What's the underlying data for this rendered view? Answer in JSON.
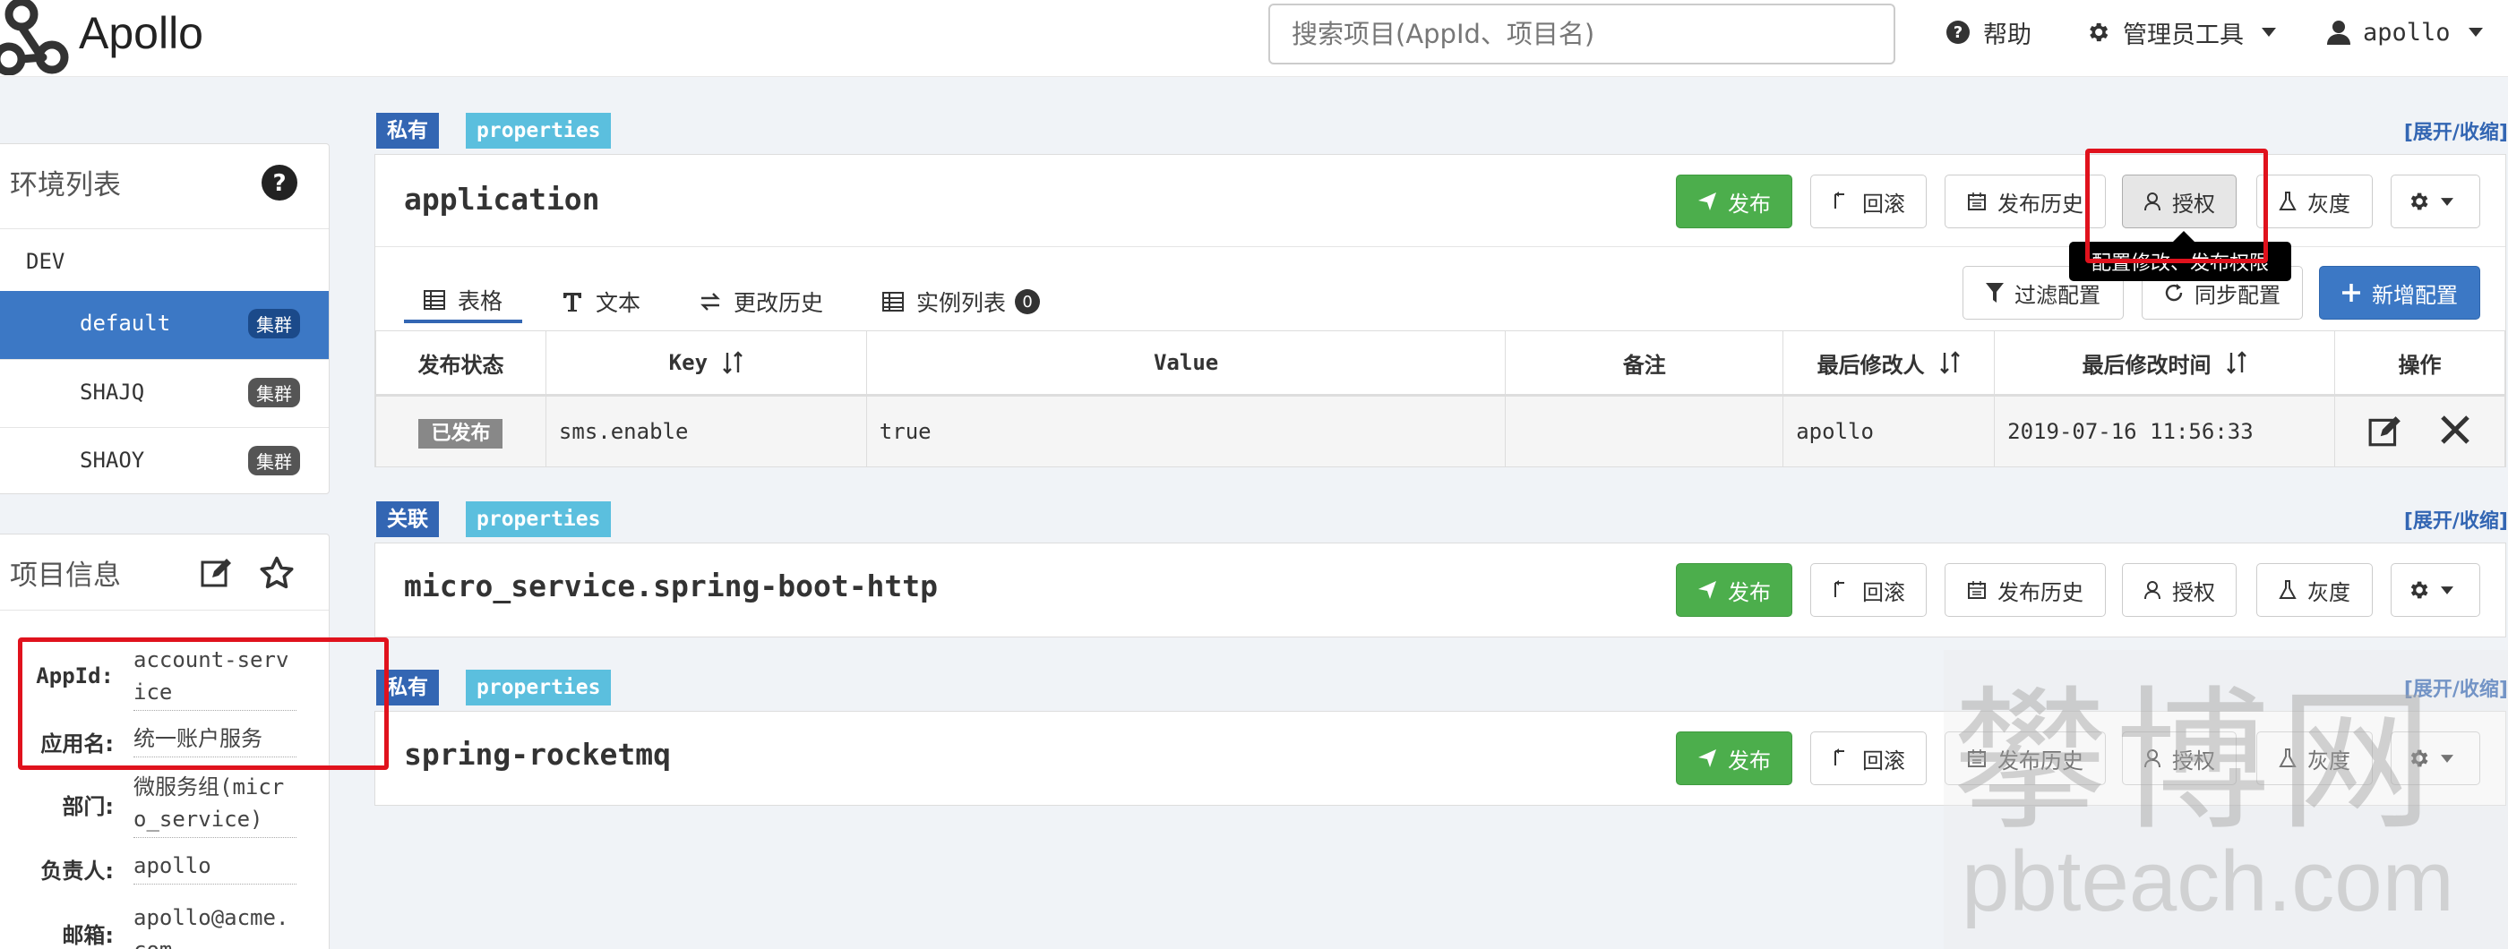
{
  "header": {
    "brand": "Apollo",
    "search_placeholder": "搜索项目(AppId、项目名)",
    "help": "帮助",
    "admin_tools": "管理员工具",
    "user": "apollo"
  },
  "sidebar": {
    "env_title": "环境列表",
    "env": "DEV",
    "clusters": [
      {
        "name": "default",
        "badge": "集群"
      },
      {
        "name": "SHAJQ",
        "badge": "集群"
      },
      {
        "name": "SHAOY",
        "badge": "集群"
      }
    ],
    "info_title": "项目信息",
    "info": [
      {
        "label": "AppId:",
        "value": "account-service"
      },
      {
        "label": "应用名:",
        "value": "统一账户服务"
      },
      {
        "label": "部门:",
        "value": "微服务组(micro_service)"
      },
      {
        "label": "负责人:",
        "value": "apollo"
      },
      {
        "label": "邮箱:",
        "value": "apollo@acme.com"
      }
    ]
  },
  "namespaces": [
    {
      "scope": "私有",
      "format": "properties",
      "toggle": "[展开/收缩]",
      "name": "application"
    },
    {
      "scope": "关联",
      "format": "properties",
      "toggle": "[展开/收缩]",
      "name": "micro_service.spring-boot-http"
    },
    {
      "scope": "私有",
      "format": "properties",
      "toggle": "[展开/收缩]",
      "name": "spring-rocketmq"
    }
  ],
  "actions": {
    "publish": "发布",
    "rollback": "回滚",
    "history": "发布历史",
    "authorize": "授权",
    "gray": "灰度"
  },
  "tooltip": "配置修改、发布权限",
  "tabs": [
    {
      "label": "表格"
    },
    {
      "label": "文本"
    },
    {
      "label": "更改历史"
    },
    {
      "label": "实例列表",
      "count": "0"
    }
  ],
  "toolbar": {
    "filter": "过滤配置",
    "sync": "同步配置",
    "add": "新增配置"
  },
  "table": {
    "headers": [
      "发布状态",
      "Key",
      "Value",
      "备注",
      "最后修改人",
      "最后修改时间",
      "操作"
    ],
    "rows": [
      {
        "status": "已发布",
        "key": "sms.enable",
        "value": "true",
        "comment": "",
        "modifier": "apollo",
        "time": "2019-07-16 11:56:33"
      }
    ]
  },
  "watermark": {
    "cn": "攀博网",
    "en": "pbteach.com"
  },
  "colors": {
    "primary": "#3c78c5",
    "success": "#4cae4c",
    "highlight": "#e0121d",
    "tag_cyan": "#5bbfde"
  }
}
